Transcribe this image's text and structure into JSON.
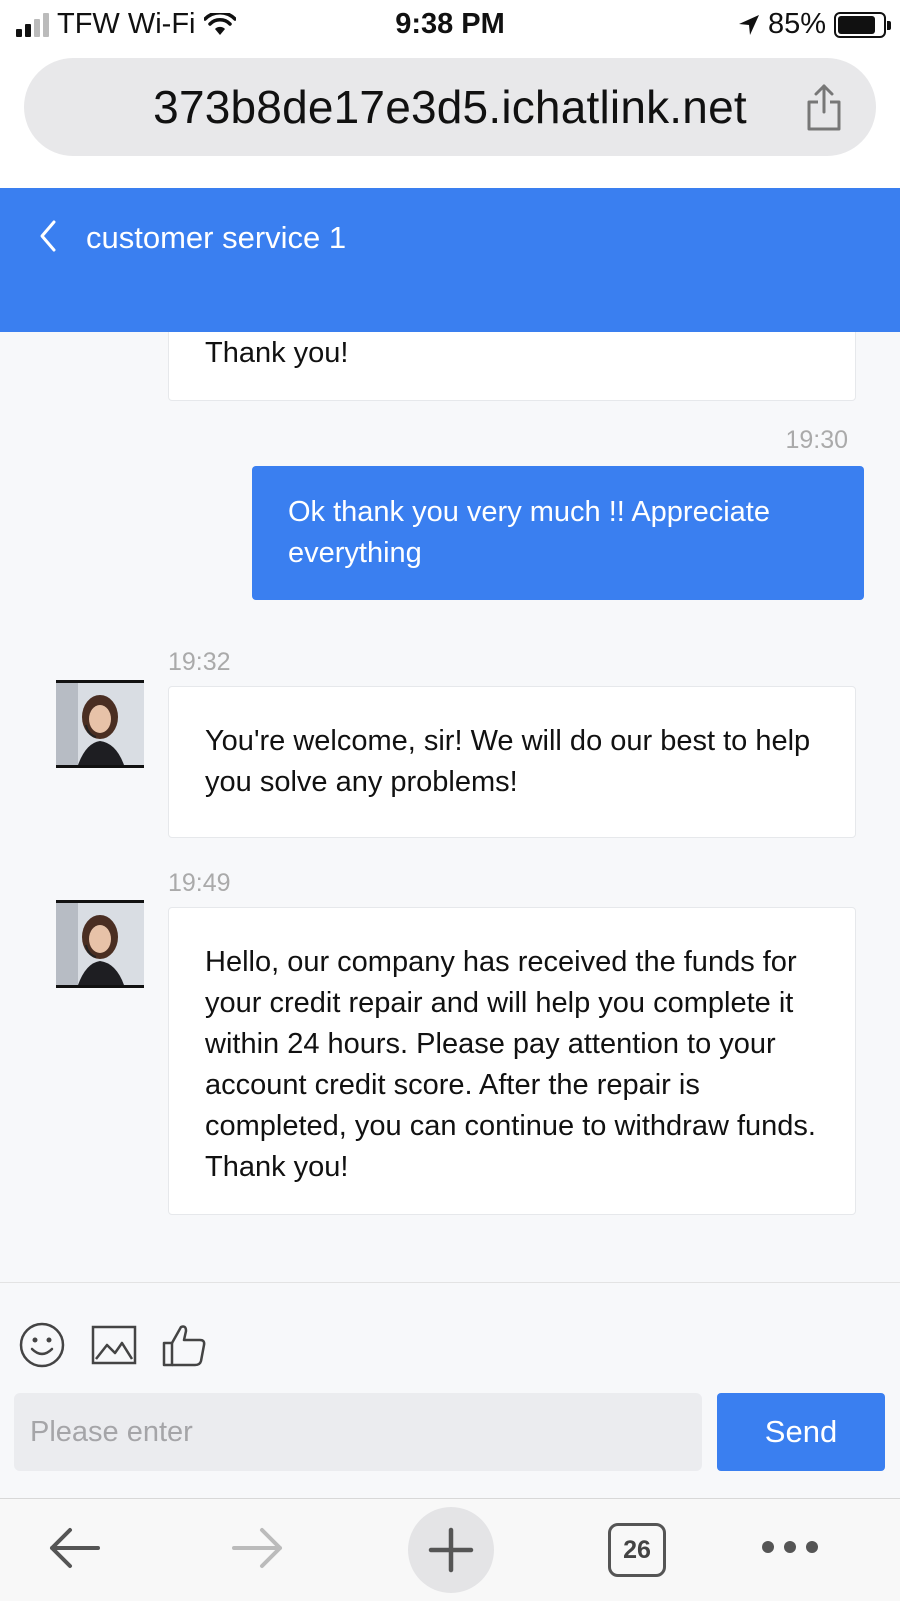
{
  "status_bar": {
    "carrier": "TFW Wi-Fi",
    "time": "9:38 PM",
    "battery": "85%",
    "battery_level": 0.85
  },
  "url_bar": {
    "url": "373b8de17e3d5.ichatlink.net",
    "share_icon": "share-icon"
  },
  "header": {
    "title": "customer service 1",
    "back_icon": "chevron-left-icon"
  },
  "messages": [
    {
      "side": "in",
      "time": "",
      "text": "Thank you!"
    },
    {
      "side": "out",
      "time": "19:30",
      "text": "Ok thank you very much !! Appreciate everything"
    },
    {
      "side": "in",
      "time": "19:32",
      "text": "You're welcome, sir! We will do our best to help you solve any problems!"
    },
    {
      "side": "in",
      "time": "19:49",
      "text": "Hello, our company has received the funds for your credit repair and will help you complete it within 24 hours. Please pay attention to your account credit score. After the repair is completed, you can continue to withdraw funds. Thank you!"
    }
  ],
  "input": {
    "tools": [
      "emoji-icon",
      "image-icon",
      "thumbs-up-icon"
    ],
    "placeholder": "Please enter",
    "send_label": "Send"
  },
  "toolbar": {
    "tab_count": "26",
    "icons": [
      "arrow-left-icon",
      "arrow-right-icon",
      "plus-icon",
      "tabs-icon",
      "more-icon"
    ]
  },
  "colors": {
    "accent": "#3a7ff0",
    "chat_background": "#f7f8fa",
    "timestamp": "#aaaaaa"
  }
}
